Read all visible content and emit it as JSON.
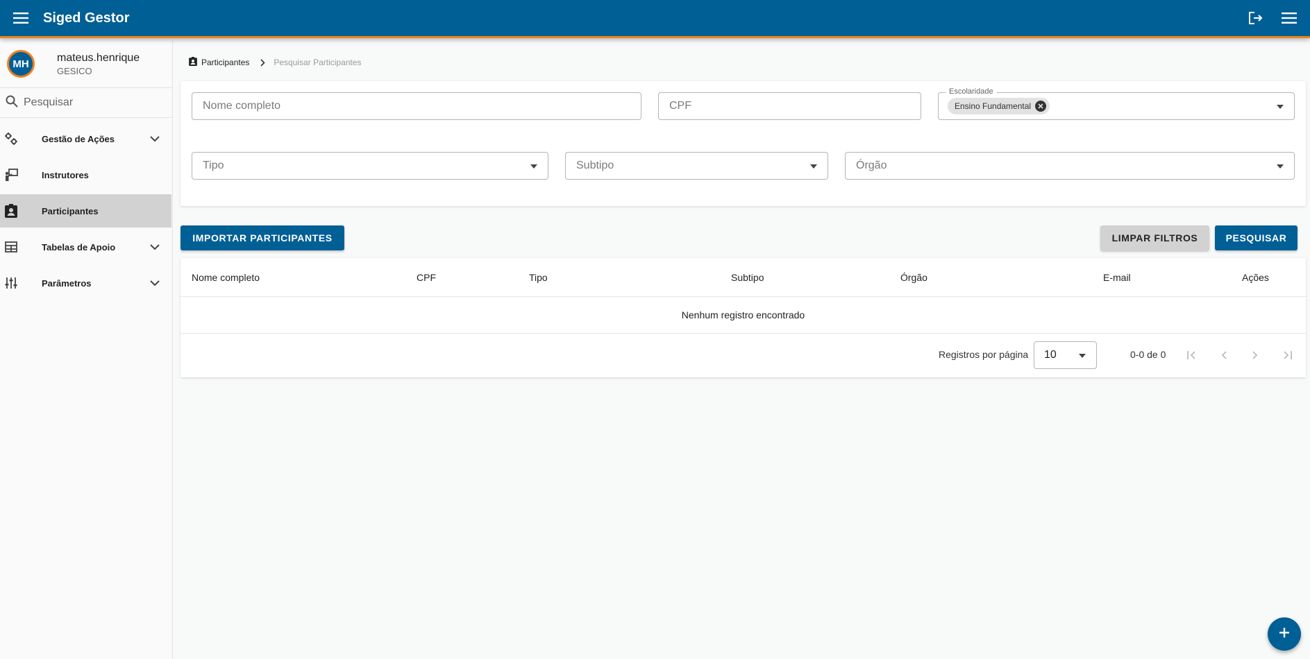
{
  "app": {
    "title": "Siged Gestor"
  },
  "header": {
    "menu_icon": "menu-icon",
    "logout_icon": "logout-icon",
    "right_menu_icon": "menu-icon"
  },
  "user": {
    "initials": "MH",
    "username": "mateus.henrique",
    "org": "GESICO"
  },
  "sidebar": {
    "search_placeholder": "Pesquisar",
    "items": [
      {
        "label": "Gestão de Ações",
        "icon": "gears-icon",
        "expandable": true
      },
      {
        "label": "Instrutores",
        "icon": "instructor-icon",
        "expandable": false
      },
      {
        "label": "Participantes",
        "icon": "contact-badge-icon",
        "expandable": false,
        "active": true
      },
      {
        "label": "Tabelas de Apoio",
        "icon": "table-icon",
        "expandable": true
      },
      {
        "label": "Parâmetros",
        "icon": "sliders-icon",
        "expandable": true
      }
    ]
  },
  "breadcrumb": {
    "item1": "Participantes",
    "item2": "Pesquisar Participantes"
  },
  "filters": {
    "nome_placeholder": "Nome completo",
    "cpf_placeholder": "CPF",
    "escolaridade_label": "Escolaridade",
    "escolaridade_chip": "Ensino Fundamental",
    "tipo_placeholder": "Tipo",
    "subtipo_placeholder": "Subtipo",
    "orgao_placeholder": "Órgão"
  },
  "actions": {
    "importar": "IMPORTAR PARTICIPANTES",
    "limpar": "LIMPAR FILTROS",
    "pesquisar": "PESQUISAR"
  },
  "table": {
    "columns": [
      "Nome completo",
      "CPF",
      "Tipo",
      "Subtipo",
      "Órgão",
      "E-mail",
      "Ações"
    ],
    "empty_message": "Nenhum registro encontrado",
    "rows_per_page_label": "Registros por página",
    "rows_per_page_value": "10",
    "range": "0-0 de 0"
  },
  "colors": {
    "primary": "#005f95",
    "accent": "#f07f1e"
  }
}
